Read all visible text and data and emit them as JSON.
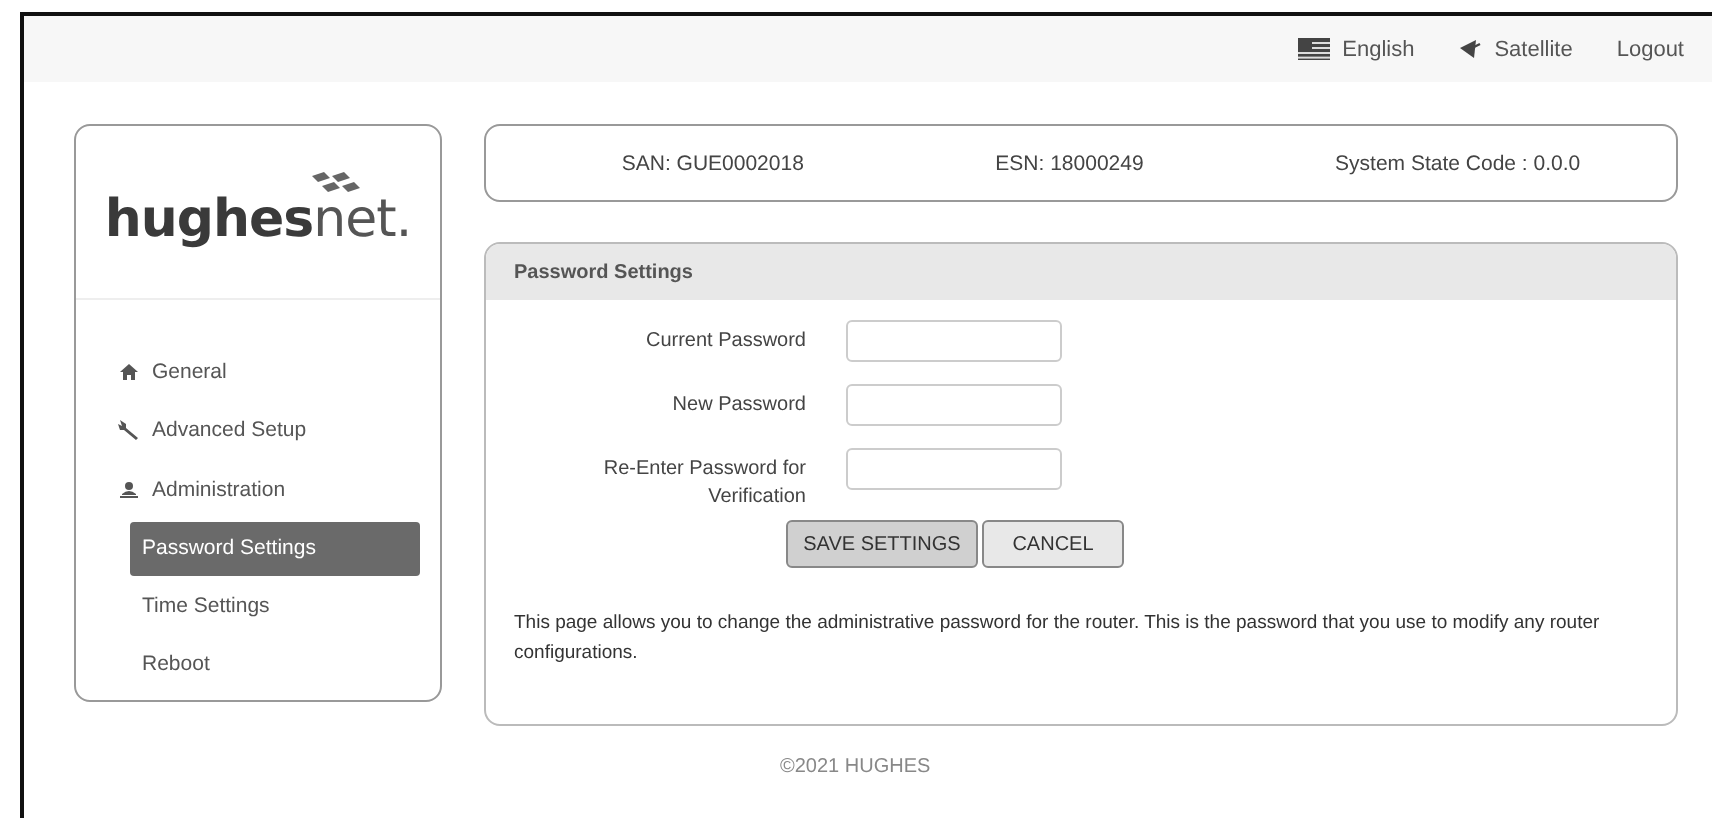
{
  "header": {
    "links": [
      {
        "kind": "language",
        "label": "English"
      },
      {
        "kind": "satellite",
        "label": "Satellite"
      },
      {
        "kind": "plain",
        "label": "Logout"
      }
    ]
  },
  "sidebar": {
    "logo": "**hughes**net.",
    "items": [
      {
        "kind": "section",
        "label": "General",
        "selected": false
      },
      {
        "kind": "section",
        "label": "Advanced Setup",
        "selected": false
      },
      {
        "kind": "section",
        "label": "Administration",
        "selected": false
      },
      {
        "kind": "page",
        "label": "Password Settings",
        "selected": true
      },
      {
        "kind": "page",
        "label": "Time Settings",
        "selected": false
      },
      {
        "kind": "page",
        "label": "Reboot",
        "selected": false
      }
    ]
  },
  "info": [
    "SAN: GUE0002018",
    "ESN: 18000249",
    "System State Code : 0.0.0"
  ],
  "panel": {
    "title": "Password Settings",
    "fields": [
      {
        "label": "Current Password"
      },
      {
        "label": "New Password"
      },
      {
        "label": "Re-Enter Password for Verification"
      }
    ],
    "buttons": [
      {
        "label": "SAVE SETTINGS",
        "kind": "primary"
      },
      {
        "label": "CANCEL",
        "kind": "secondary"
      }
    ],
    "description": "This page allows you to change the administrative password for the router. This is the password that you use to modify any router configurations."
  },
  "footer": "©2021 HUGHES"
}
